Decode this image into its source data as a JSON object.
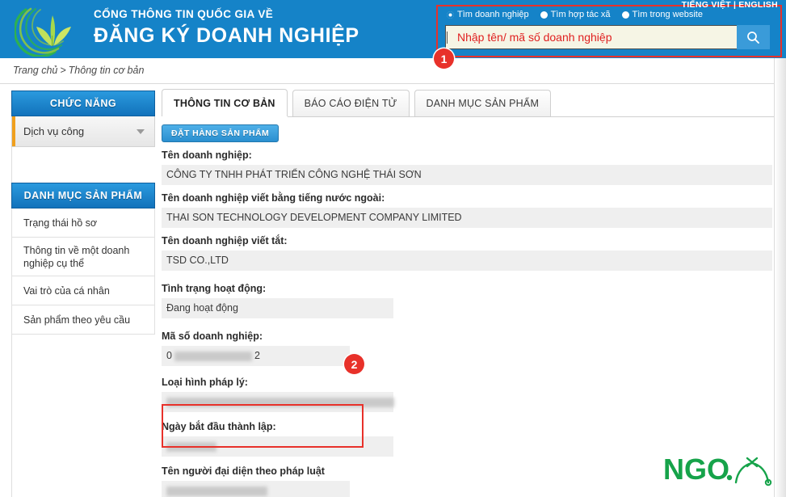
{
  "header": {
    "brand_line1": "CỔNG THÔNG TIN QUỐC GIA VỀ",
    "brand_line2": "ĐĂNG KÝ DOANH NGHIỆP",
    "logo_icon": "leaf-swirl-logo",
    "lang_vietnamese": "TIẾNG VIỆT",
    "lang_separator": "|",
    "lang_english": "ENGLISH",
    "accent_blue": "#1583c8",
    "annotation_red": "#e8312a"
  },
  "search": {
    "radios": [
      {
        "label": "Tìm doanh nghiệp",
        "checked": true
      },
      {
        "label": "Tìm hợp tác xã",
        "checked": false
      },
      {
        "label": "Tìm trong website",
        "checked": false
      }
    ],
    "placeholder": "Nhập tên/ mã số doanh nghiệp",
    "value": "",
    "button_icon": "search-icon",
    "input_bg": "#f6f5e5",
    "placeholder_color": "#e02020"
  },
  "annotations": [
    {
      "id": "1",
      "label": "1",
      "target": "search-panel"
    },
    {
      "id": "2",
      "label": "2",
      "target": "ma-so-doanh-nghiep-field"
    }
  ],
  "breadcrumb": {
    "home": "Trang chủ",
    "separator": ">",
    "current": "Thông tin cơ bản"
  },
  "sidebar": {
    "functions_panel": {
      "title": "CHỨC NĂNG",
      "items": [
        {
          "label": "Dịch vụ công",
          "has_caret": true,
          "accent": "#f0a01e"
        }
      ]
    },
    "catalog_panel": {
      "title": "DANH MỤC SẢN PHẨM",
      "items": [
        {
          "label": "Trạng thái hồ sơ"
        },
        {
          "label": "Thông tin về một doanh nghiệp cụ thể"
        },
        {
          "label": "Vai trò của cá nhân"
        },
        {
          "label": "Sản phẩm theo yêu cầu"
        }
      ]
    }
  },
  "main": {
    "tabs": [
      {
        "label": "THÔNG TIN CƠ BẢN",
        "active": true
      },
      {
        "label": "BÁO CÁO ĐIỆN TỬ",
        "active": false
      },
      {
        "label": "DANH MỤC SẢN PHẨM",
        "active": false
      }
    ],
    "order_button": "ĐẶT HÀNG SẢN PHẨM",
    "fields": [
      {
        "label": "Tên doanh nghiệp:",
        "value": "CÔNG TY TNHH PHÁT TRIỂN CÔNG NGHỆ THÁI SƠN",
        "redacted": false
      },
      {
        "label": "Tên doanh nghiệp viết bằng tiếng nước ngoài:",
        "value": "THAI SON TECHNOLOGY DEVELOPMENT COMPANY LIMITED",
        "redacted": false
      },
      {
        "label": "Tên doanh nghiệp viết tắt:",
        "value": "TSD CO.,LTD",
        "redacted": false
      },
      {
        "label": "Tình trạng hoạt động:",
        "value": "Đang hoạt động",
        "redacted": false
      },
      {
        "label": "Mã số doanh nghiệp:",
        "value_prefix": "0",
        "value_suffix": "2",
        "redacted": true
      },
      {
        "label": "Loại hình pháp lý:",
        "value": "",
        "redacted": true
      },
      {
        "label": "Ngày bắt đầu thành lập:",
        "value": "",
        "redacted": true
      },
      {
        "label": "Tên người đại diện theo pháp luật",
        "value": "",
        "redacted": true
      }
    ]
  },
  "watermark": {
    "text": "NGO",
    "color": "#16a34a"
  }
}
